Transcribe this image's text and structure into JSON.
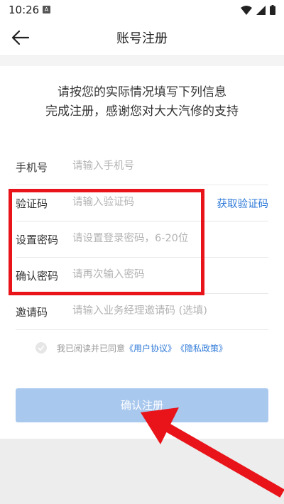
{
  "status_bar": {
    "time": "10:26",
    "notification_badge": "A",
    "icons": [
      "wifi-icon",
      "cellular-signal-icon",
      "battery-icon"
    ]
  },
  "header": {
    "back_icon": "arrow-left-icon",
    "title": "账号注册"
  },
  "intro": {
    "line1": "请按您的实际情况填写下列信息",
    "line2": "完成注册，感谢您对大大汽修的支持"
  },
  "form": {
    "phone": {
      "label": "手机号",
      "placeholder": "请输入手机号",
      "value": ""
    },
    "code": {
      "label": "验证码",
      "placeholder": "请输入验证码",
      "value": "",
      "action": "获取验证码"
    },
    "password": {
      "label": "设置密码",
      "placeholder": "请设置登录密码，6-20位",
      "value": ""
    },
    "confirm_password": {
      "label": "确认密码",
      "placeholder": "请再次输入密码",
      "value": ""
    },
    "invite": {
      "label": "邀请码",
      "placeholder": "请输入业务经理邀请码 (选填)",
      "value": ""
    }
  },
  "agreement": {
    "checked": false,
    "text": "我已阅读并已同意",
    "user_agreement": "《用户协议》",
    "privacy_policy": "《隐私政策》"
  },
  "submit": {
    "label": "确认注册",
    "enabled": false
  },
  "colors": {
    "link": "#2f7ad8",
    "submit_disabled": "#a9c8ee",
    "annotation": "#e8141a"
  }
}
